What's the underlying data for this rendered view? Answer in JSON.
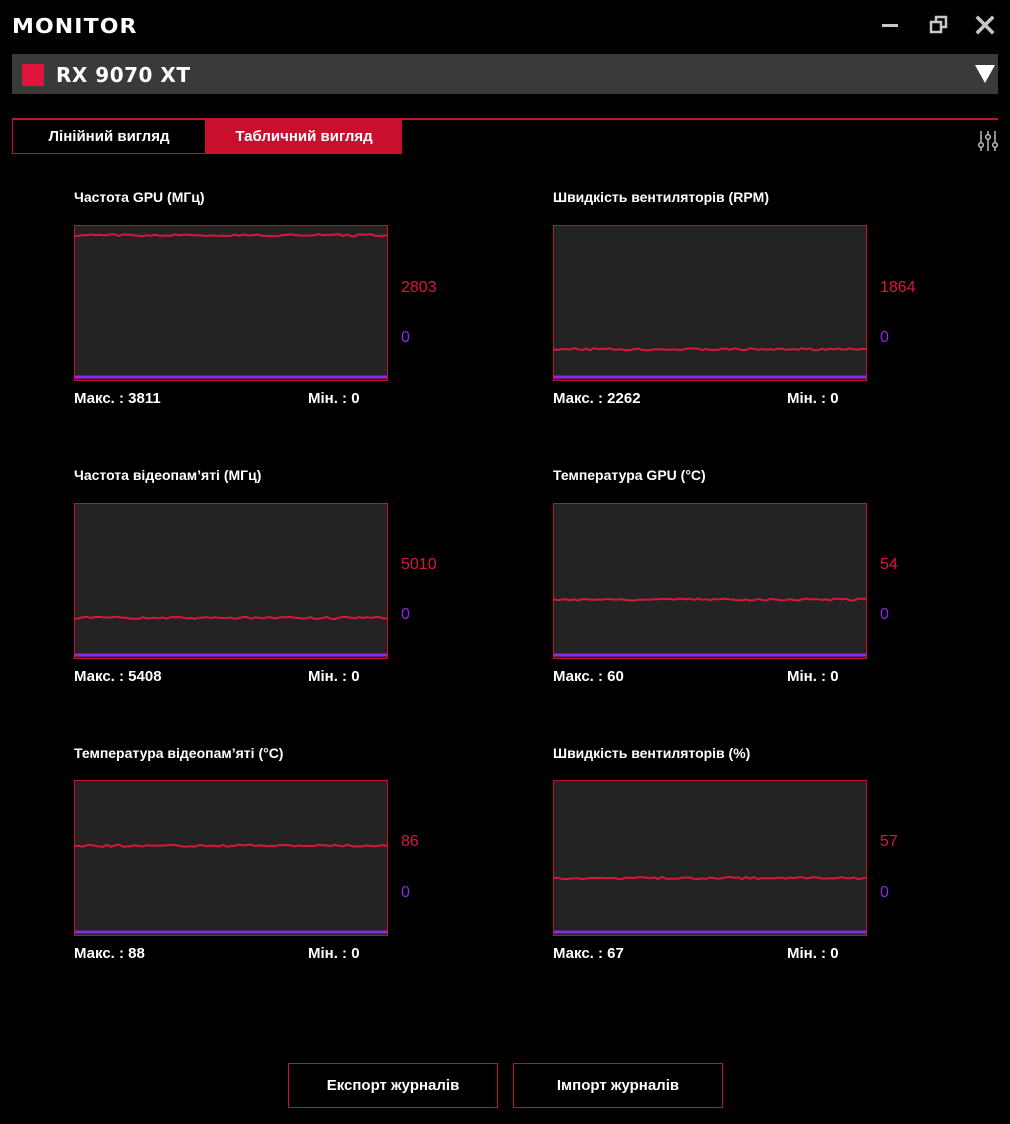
{
  "app": {
    "title": "MONITOR"
  },
  "device": {
    "name": "RX 9070 XT",
    "accent": "#e0143c"
  },
  "tabs": {
    "linear": "Лінійний вигляд",
    "table": "Табличний вигляд"
  },
  "colors": {
    "accent": "#c8102e",
    "value_line": "#d9163e",
    "zero_line": "#8a2be2",
    "chart_bg": "#232323"
  },
  "charts": [
    {
      "title": "Частота GPU (МГц)",
      "current": "2803",
      "zero": "0",
      "max_label": "Макс. : 3811",
      "min_label": "Мін. : 0",
      "max": 3811,
      "value": 2803,
      "line_fraction": 0.94
    },
    {
      "title": "Швидкість вентиляторів (RPM)",
      "current": "1864",
      "zero": "0",
      "max_label": "Макс. : 2262",
      "min_label": "Мін. : 0",
      "max": 2262,
      "value": 1864,
      "line_fraction": 0.2
    },
    {
      "title": "Частота відеопам’яті (МГц)",
      "current": "5010",
      "zero": "0",
      "max_label": "Макс. : 5408",
      "min_label": "Мін. : 0",
      "max": 5408,
      "value": 5010,
      "line_fraction": 0.26
    },
    {
      "title": "Температура GPU (°C)",
      "current": "54",
      "zero": "0",
      "max_label": "Макс. : 60",
      "min_label": "Мін. : 0",
      "max": 60,
      "value": 54,
      "line_fraction": 0.38
    },
    {
      "title": "Температура відеопам’яті (°C)",
      "current": "86",
      "zero": "0",
      "max_label": "Макс. : 88",
      "min_label": "Мін. : 0",
      "max": 88,
      "value": 86,
      "line_fraction": 0.58
    },
    {
      "title": "Швидкість вентиляторів (%)",
      "current": "57",
      "zero": "0",
      "max_label": "Макс. : 67",
      "min_label": "Мін. : 0",
      "max": 67,
      "value": 57,
      "line_fraction": 0.37
    }
  ],
  "buttons": {
    "export": "Експорт журналів",
    "import": "Імпорт журналів"
  }
}
